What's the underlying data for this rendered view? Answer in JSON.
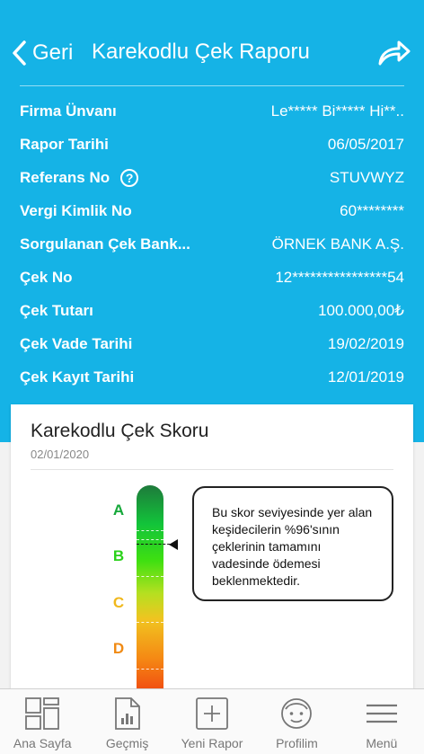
{
  "nav": {
    "back_label": "Geri",
    "title": "Karekodlu Çek Raporu"
  },
  "rows": [
    {
      "label": "Firma Ünvanı",
      "value": "Le***** Bi***** Hi**.."
    },
    {
      "label": "Rapor Tarihi",
      "value": "06/05/2017"
    },
    {
      "label": "Referans No",
      "value": "STUVWYZ",
      "help": "?"
    },
    {
      "label": "Vergi Kimlik No",
      "value": "60********"
    },
    {
      "label": "Sorgulanan Çek Bank...",
      "value": "ÖRNEK BANK A.Ş."
    },
    {
      "label": "Çek No",
      "value": "12****************54"
    },
    {
      "label": "Çek Tutarı",
      "value": "100.000,00₺"
    },
    {
      "label": "Çek Vade Tarihi",
      "value": "19/02/2019"
    },
    {
      "label": "Çek Kayıt Tarihi",
      "value": "12/01/2019"
    }
  ],
  "score": {
    "title": "Karekodlu Çek Skoru",
    "date": "02/01/2020",
    "grades": [
      {
        "letter": "A",
        "color": "#16a83a"
      },
      {
        "letter": "B",
        "color": "#2ad11a"
      },
      {
        "letter": "C",
        "color": "#f0b81c"
      },
      {
        "letter": "D",
        "color": "#f08a14"
      }
    ],
    "description": "Bu skor seviyesinde yer alan keşidecilerin %96'sının çeklerinin tamamını vadesinde ödemesi beklenmektedir."
  },
  "tabs": [
    {
      "label": "Ana Sayfa",
      "icon": "grid-icon"
    },
    {
      "label": "Geçmiş",
      "icon": "report-icon"
    },
    {
      "label": "Yeni Rapor",
      "icon": "plus-box-icon"
    },
    {
      "label": "Profilim",
      "icon": "face-icon"
    },
    {
      "label": "Menü",
      "icon": "menu-icon"
    }
  ],
  "colors": {
    "header_bg": "#15b3e6",
    "tab_icon": "#777777"
  }
}
